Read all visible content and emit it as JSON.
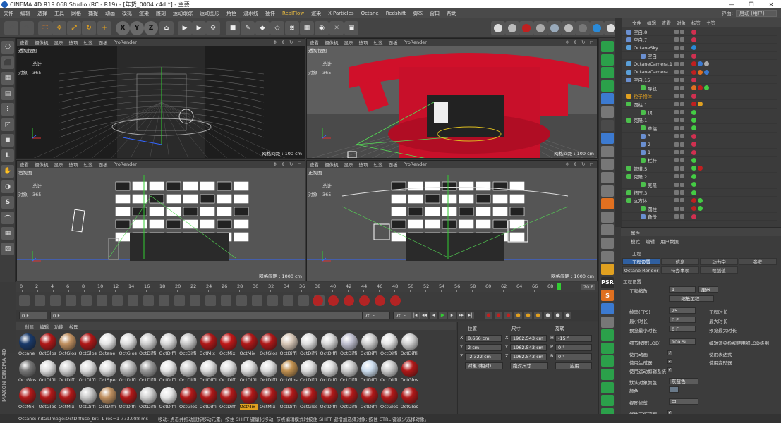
{
  "window": {
    "title": "CINEMA 4D R19.068 Studio (RC - R19) - [年货_0004.c4d *] - 主要",
    "controls": [
      "—",
      "❐",
      "✕"
    ]
  },
  "menubar": {
    "items": [
      "文件",
      "编辑",
      "选择",
      "工具",
      "网格",
      "捕捉",
      "动画",
      "模拟",
      "渲染",
      "雕刻",
      "运动跟踪",
      "运动图形",
      "角色",
      "流水线",
      "插件",
      "RealFlow",
      "渲染",
      "X-Particles",
      "Octane",
      "Redshift",
      "脚本",
      "窗口",
      "帮助"
    ],
    "layout_label": "界面:",
    "layout_value": "启动 (用户)"
  },
  "toolbar": {
    "axes": [
      "X",
      "Y",
      "Z"
    ]
  },
  "viewports": [
    {
      "name": "透视视图",
      "menu": [
        "查看",
        "摄像机",
        "显示",
        "选项",
        "过滤",
        "面板",
        "ProRender"
      ],
      "stat_label": "总计",
      "obj_label": "对象",
      "obj_count": "365",
      "grid": "网格间距 : 100 cm"
    },
    {
      "name": "透视视图",
      "menu": [
        "查看",
        "摄像机",
        "显示",
        "选项",
        "过滤",
        "面板",
        "ProRender"
      ],
      "stat_label": "总计",
      "obj_label": "对象",
      "obj_count": "365",
      "grid": "网格间距 : 100 cm"
    },
    {
      "name": "右视图",
      "menu": [
        "查看",
        "摄像机",
        "显示",
        "选项",
        "过滤",
        "面板",
        "ProRender"
      ],
      "stat_label": "总计",
      "obj_label": "对象",
      "obj_count": "365",
      "grid": "网格间距 : 1000 cm"
    },
    {
      "name": "正视图",
      "menu": [
        "查看",
        "摄像机",
        "显示",
        "选项",
        "过滤",
        "面板",
        "ProRender"
      ],
      "stat_label": "总计",
      "obj_label": "对象",
      "obj_count": "365",
      "grid": "网格间距 : 1000 cm"
    }
  ],
  "object_manager": {
    "menu": [
      "文件",
      "编辑",
      "查看",
      "对象",
      "标签",
      "书签"
    ],
    "rows": [
      {
        "name": "空白.8",
        "color": "#6a8fd0"
      },
      {
        "name": "空白.7",
        "color": "#6a8fd0"
      },
      {
        "name": "OctaneSky",
        "color": "#5a9fd8"
      },
      {
        "name": "空白",
        "color": "#6a8fd0"
      },
      {
        "name": "OctaneCamera.1",
        "color": "#5a9fd8"
      },
      {
        "name": "OctaneCamera",
        "color": "#5a9fd8"
      },
      {
        "name": "空白.15",
        "color": "#6a8fd0"
      },
      {
        "name": "导轨",
        "color": "#4cc04c"
      },
      {
        "name": "粒子物体",
        "color": "#e0a020",
        "orange": true
      },
      {
        "name": "圆柱.1",
        "color": "#4cc04c"
      },
      {
        "name": "顶",
        "color": "#4cc04c"
      },
      {
        "name": "克隆.1",
        "color": "#4cc04c"
      },
      {
        "name": "草稿",
        "color": "#4cc04c"
      },
      {
        "name": "3",
        "color": "#6a8fd0"
      },
      {
        "name": "2",
        "color": "#6a8fd0"
      },
      {
        "name": "1",
        "color": "#6a8fd0"
      },
      {
        "name": "栏杆",
        "color": "#4cc04c"
      },
      {
        "name": "管道.5",
        "color": "#4cc04c"
      },
      {
        "name": "克隆.2",
        "color": "#4cc04c"
      },
      {
        "name": "克隆",
        "color": "#4cc04c"
      },
      {
        "name": "挤压.3",
        "color": "#4cc04c"
      },
      {
        "name": "立方体",
        "color": "#4cc04c"
      },
      {
        "name": "圆柱",
        "color": "#4cc04c"
      },
      {
        "name": "备份",
        "color": "#6a8fd0"
      }
    ]
  },
  "attributes": {
    "title": "属性",
    "menu": [
      "模式",
      "编辑",
      "用户数据"
    ],
    "section": "工程",
    "tabs_row1": [
      "工程设置",
      "信息",
      "动力学",
      "参考"
    ],
    "tabs_row2": [
      "Octane Render",
      "待办事项",
      "帧插值"
    ],
    "group": "工程设置",
    "scale_label": "工程缩放",
    "scale_value": "1",
    "scale_unit": "厘米",
    "scale_button": "缩放工程...",
    "fps_label": "帧率(FPS)",
    "fps_value": "25",
    "min_time_label": "最小时长",
    "min_time_value": "0 F",
    "preview_min_label": "预览最小时长",
    "preview_min_value": "0 F",
    "project_time_label": "工程时长",
    "max_time_label": "最大时长",
    "preview_max_label": "预览最大时长",
    "lod_label": "细节程度(LOD)",
    "lod_value": "100 %",
    "lod_right": "编辑渲染检视使用细LOD级别",
    "use_anim": "使用动画",
    "use_expr": "使用表达式",
    "use_gen": "使用生成器",
    "use_deform": "使用变形器",
    "use_motion": "使用运动剪辑系统",
    "default_color_label": "默认对象颜色",
    "default_color_value": "灰蓝色",
    "color_label": "颜色",
    "view_clip_label": "视图修剪",
    "view_clip_value": "中",
    "linear_label": "线性工作流程"
  },
  "timeline": {
    "ticks": [
      "0",
      "2",
      "4",
      "6",
      "8",
      "10",
      "12",
      "14",
      "16",
      "18",
      "20",
      "22",
      "24",
      "26",
      "28",
      "30",
      "32",
      "34",
      "36",
      "38",
      "40",
      "42",
      "44",
      "46",
      "48",
      "50",
      "52",
      "54",
      "56",
      "58",
      "60",
      "62",
      "64",
      "66",
      "68"
    ],
    "end": "70 F",
    "current_frame": 69
  },
  "transport": {
    "start": "0 F",
    "cur": "0 F",
    "end": "70 F",
    "end2": "70 F"
  },
  "materials": {
    "menu": [
      "创建",
      "编辑",
      "功能",
      "纹理"
    ],
    "rows": [
      [
        "Octane",
        "OctGlos",
        "OctGlos",
        "OctGlos",
        "Octane",
        "OctGlos",
        "OctDiffi",
        "OctDiffi",
        "OctDiffi",
        "OctMix",
        "OctMix",
        "OctMix",
        "OctGlos",
        "OctDiffi",
        "OctDiffi",
        "OctDiffi",
        "OctDiffi",
        "OctDiffi",
        "OctDiffi",
        "OctDiffi"
      ],
      [
        "OctGlos",
        "OctDiffi",
        "OctDiffi",
        "OctDiffi",
        "OctSpec",
        "OctDiffi",
        "OctDiffi",
        "OctDiffi",
        "OctDiffi",
        "OctDiffi",
        "OctDiffi",
        "OctDiffi",
        "OctDiffi",
        "OctGlos",
        "OctDiffi",
        "OctDiffi",
        "OctDiffi",
        "OctDiffi",
        "OctDiffi",
        "OctGlos"
      ],
      [
        "OctMix",
        "OctGlos",
        "OctMix",
        "OctDiffi",
        "OctDiffi",
        "OctDiffi",
        "OctDiffi",
        "OctDiffi",
        "OctGlos",
        "OctDiffi",
        "OctDiffi",
        "OctMix",
        "OctMix",
        "OctDiffi",
        "OctGlos",
        "OctDiffi",
        "OctDiffi",
        "OctDiffi",
        "OctGlos",
        "OctGlos"
      ]
    ],
    "selected": "2-11"
  },
  "coordinates": {
    "headers": [
      "位置",
      "尺寸",
      "旋转"
    ],
    "rows": [
      {
        "axis": "X",
        "pos": "8.666 cm",
        "size_axis": "X",
        "size": "1962.543 cm",
        "rot_axis": "H",
        "rot": "-15 °"
      },
      {
        "axis": "Y",
        "pos": "2 cm",
        "size_axis": "Y",
        "size": "1962.543 cm",
        "rot_axis": "P",
        "rot": "0 °"
      },
      {
        "axis": "Z",
        "pos": "-2.322 cm",
        "size_axis": "Z",
        "size": "1962.543 cm",
        "rot_axis": "B",
        "rot": "0 °"
      }
    ],
    "mode": "对象 (相对)",
    "size_mode": "绝对尺寸",
    "apply": "应用"
  },
  "status": {
    "left": "Octane:InitGLImage:OctDiffuse_bit:-1 res=1 773.088 ms",
    "msg": "移动: 点击并拖动鼠标移动元素。按住 SHIFT 键量化移动; 节点编辑模式时按住 SHIFT 键增加选择对象; 按住 CTRL 键减少选择对象。"
  },
  "maxon": "MAXON CINEMA 4D"
}
